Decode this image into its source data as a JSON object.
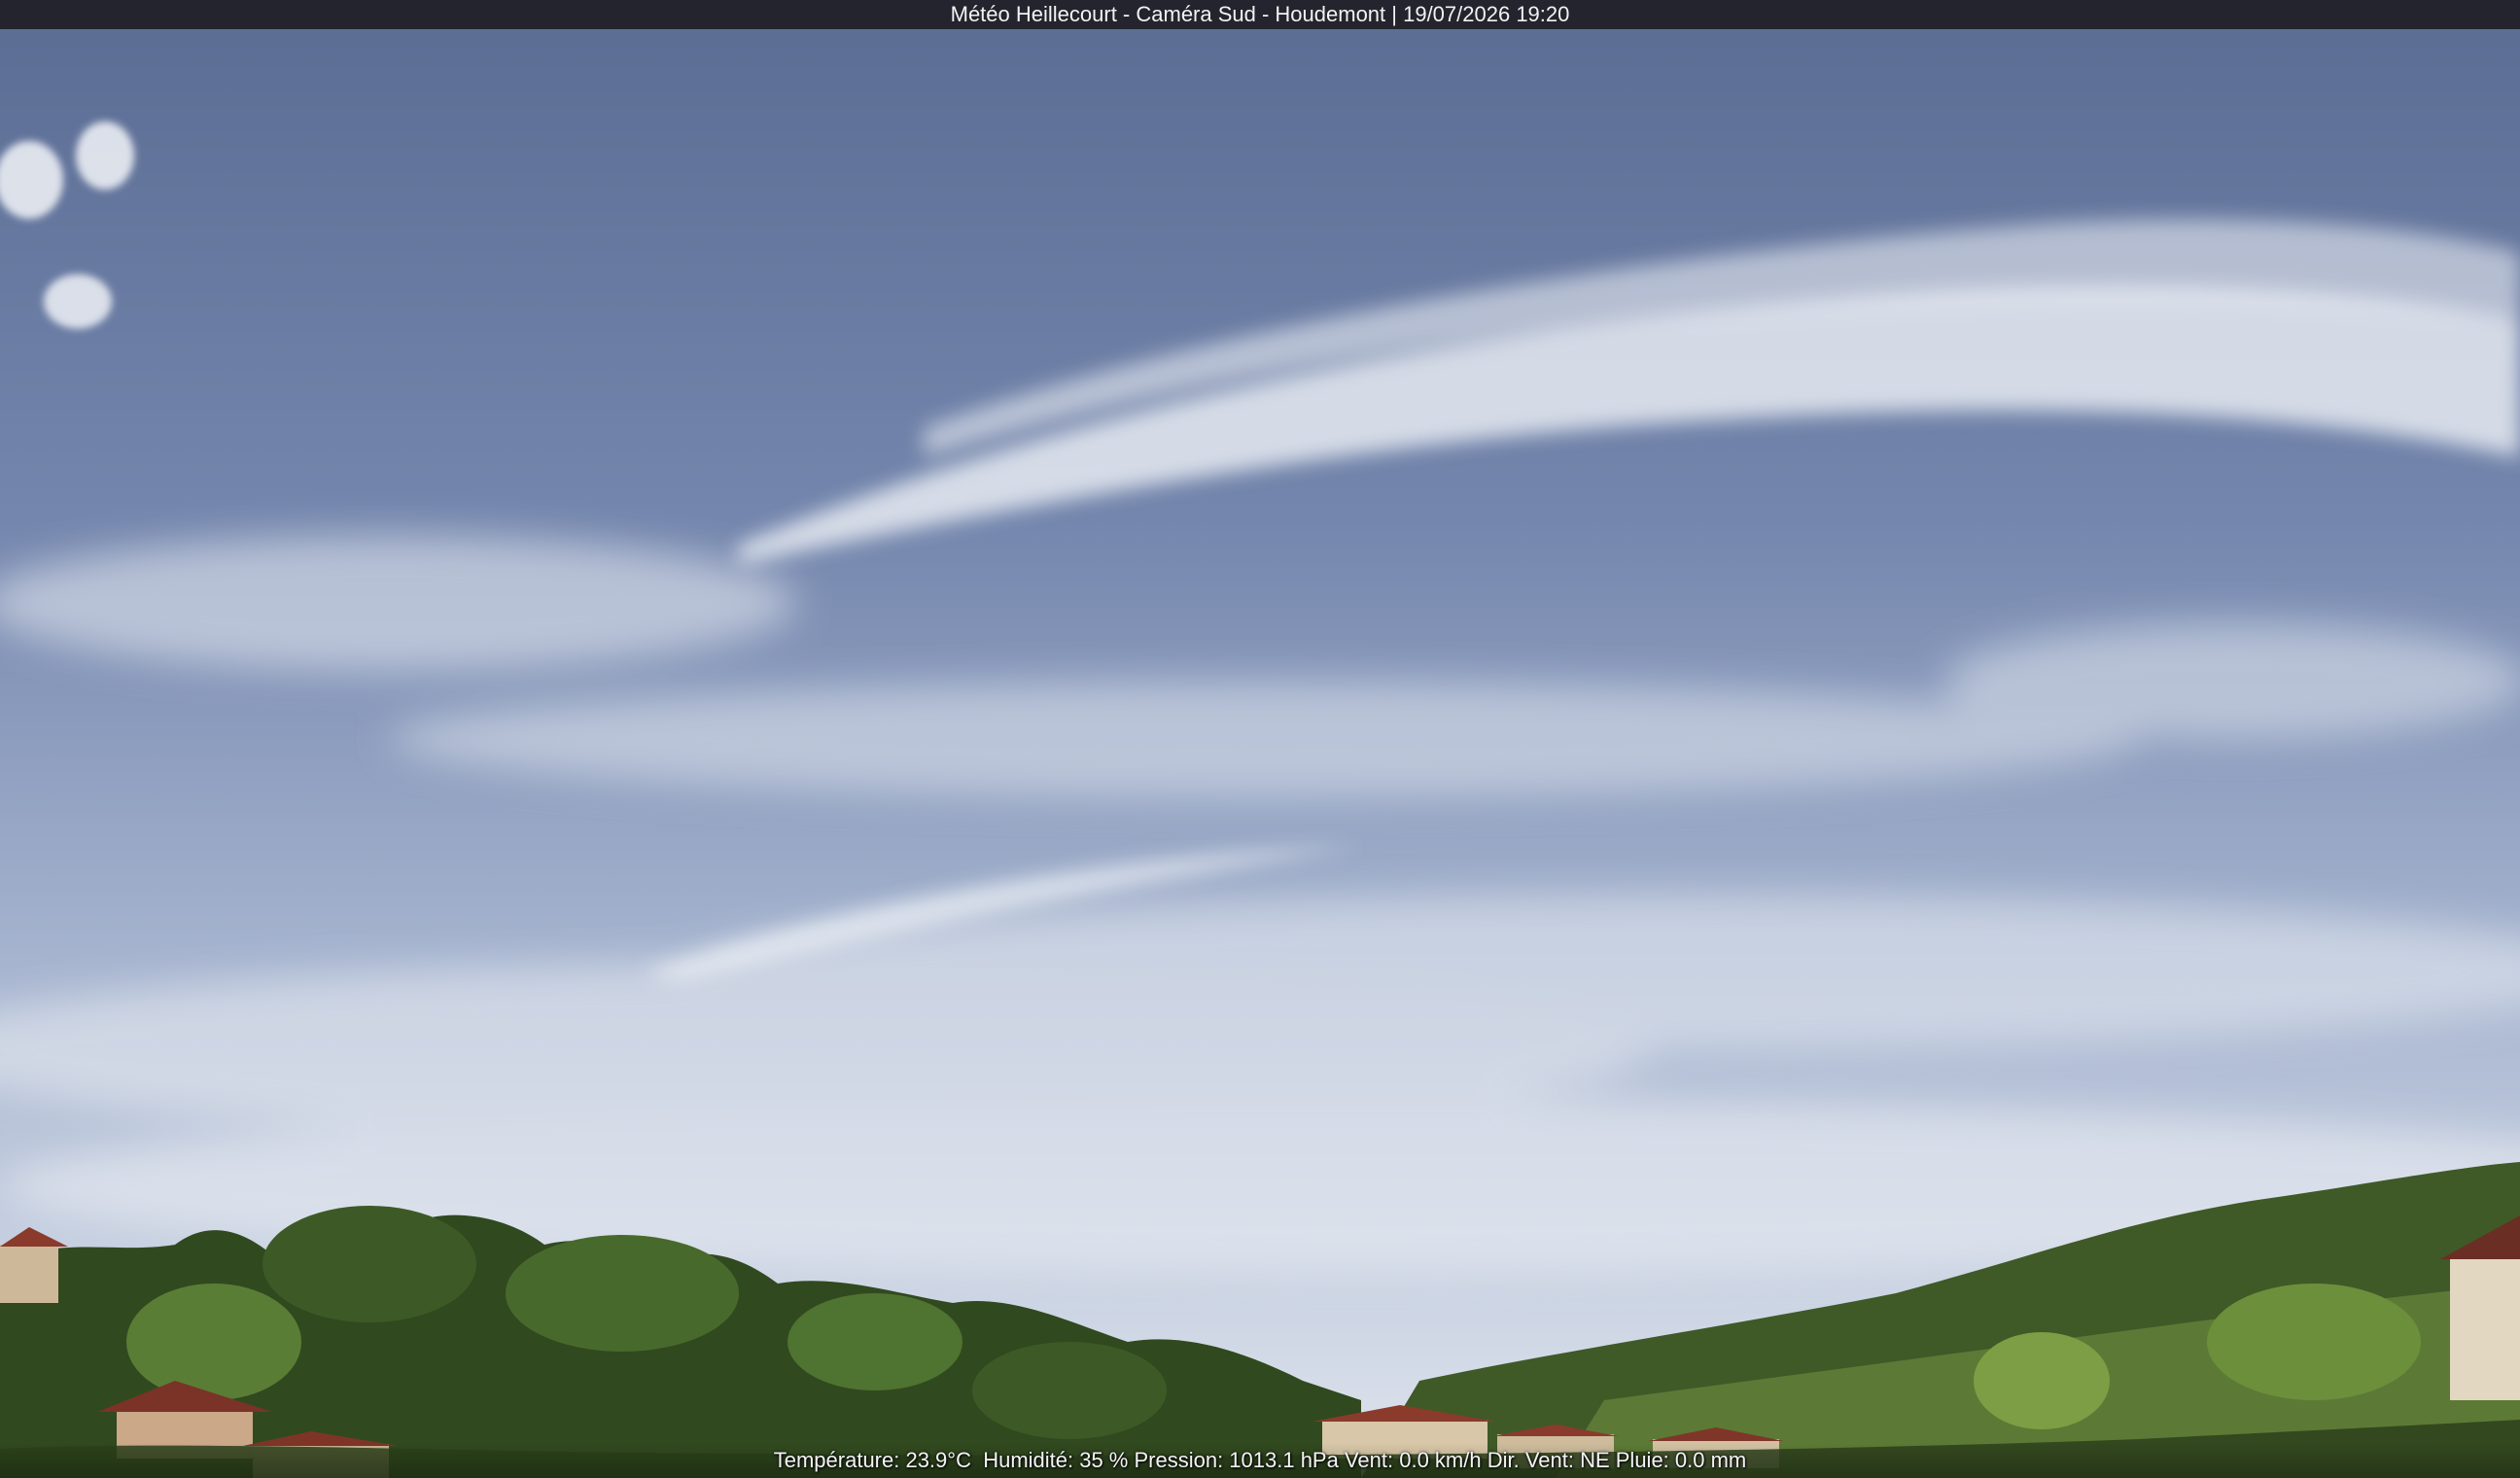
{
  "header": {
    "title": "Météo Heillecourt - Caméra Sud - Houdemont | 19/07/2026 19:20"
  },
  "weather_overlay": {
    "text": "Température: 23.9°C  Humidité: 35 % Pression: 1013.1 hPa Vent: 0.0 km/h Dir. Vent: NE Pluie: 0.0 mm"
  },
  "scene": {
    "description_icon": "webcam-sky-icon"
  },
  "colors": {
    "sky_top": "#5e6f95",
    "sky_mid": "#8c9fc0",
    "sky_horizon": "#d5dde9",
    "cloud": "#eef1f6",
    "foliage_dark": "#2f4a1f",
    "foliage_light": "#6e8f3a",
    "roof": "#8a3b2c",
    "bar": "#1e1e24"
  }
}
